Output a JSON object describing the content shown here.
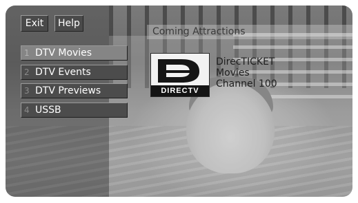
{
  "top_buttons": {
    "exit": "Exit",
    "help": "Help"
  },
  "title": "Coming Attractions",
  "menu": [
    {
      "number": "1",
      "label": "DTV Movies",
      "selected": true
    },
    {
      "number": "2",
      "label": "DTV Events",
      "selected": false
    },
    {
      "number": "3",
      "label": "DTV Previews",
      "selected": false
    },
    {
      "number": "4",
      "label": "USSB",
      "selected": false
    }
  ],
  "logo": {
    "brand_text": "DIRECTV",
    "icon": "directv-logo-icon"
  },
  "info": {
    "line1": "DirecTICKET",
    "line2": "Movies",
    "line3": "Channel 100"
  }
}
